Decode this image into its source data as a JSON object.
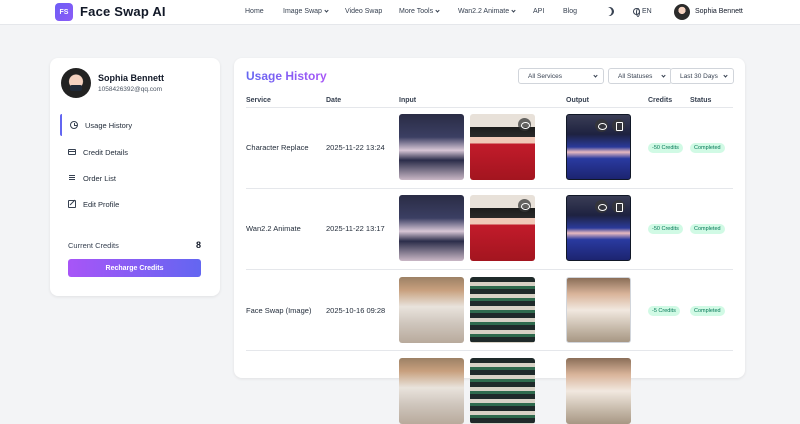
{
  "brand": {
    "logo_badge": "FS",
    "name": "Face Swap AI"
  },
  "nav": {
    "home": "Home",
    "image_swap": "Image Swap",
    "video_swap": "Video Swap",
    "more_tools": "More Tools",
    "wan_animate": "Wan2.2 Animate",
    "api": "API",
    "blog": "Blog",
    "language": "EN",
    "user_name": "Sophia Bennett"
  },
  "sidebar": {
    "user_name": "Sophia Bennett",
    "user_email": "1058426392@qq.com",
    "items": [
      {
        "label": "Usage History",
        "icon": "clock-icon",
        "active": true
      },
      {
        "label": "Credit Details",
        "icon": "credit-card-icon",
        "active": false
      },
      {
        "label": "Order List",
        "icon": "list-icon",
        "active": false
      },
      {
        "label": "Edit Profile",
        "icon": "edit-icon",
        "active": false
      }
    ],
    "credits_label": "Current Credits",
    "credits_value": "8",
    "recharge_label": "Recharge Credits"
  },
  "main": {
    "title": "Usage History",
    "filters": {
      "service": "All Services",
      "status": "All Statuses",
      "period": "Last 30 Days"
    },
    "columns": {
      "service": "Service",
      "date": "Date",
      "input": "Input",
      "output": "Output",
      "credits": "Credits",
      "status": "Status"
    },
    "rows": [
      {
        "service": "Character Replace",
        "date": "2025-11-22 13:24",
        "credits": "-50 Credits",
        "status": "Completed"
      },
      {
        "service": "Wan2.2 Animate",
        "date": "2025-11-22 13:17",
        "credits": "-50 Credits",
        "status": "Completed"
      },
      {
        "service": "Face Swap (Image)",
        "date": "2025-10-16 09:28",
        "credits": "-5 Credits",
        "status": "Completed"
      }
    ]
  },
  "colors": {
    "accent": "#6366f1",
    "accent2": "#a855f7",
    "status_bg": "#d1fae5",
    "status_text": "#047857"
  }
}
